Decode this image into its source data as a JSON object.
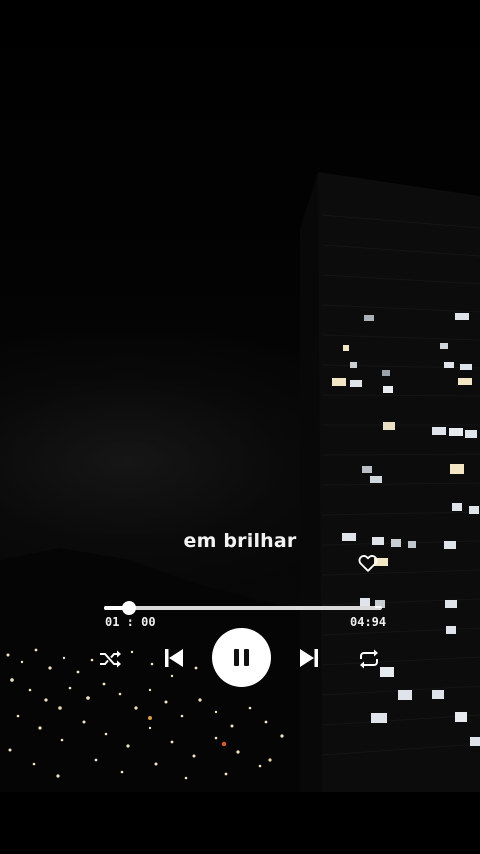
{
  "player": {
    "lyric": "em brilhar",
    "time_elapsed": "01 : 00",
    "time_total": "04:94",
    "progress_fraction": 0.09,
    "is_playing": true,
    "liked": false
  },
  "icons": {
    "heart": "heart-icon",
    "shuffle": "shuffle-icon",
    "previous": "skip-previous-icon",
    "pause": "pause-icon",
    "next": "skip-next-icon",
    "repeat": "repeat-icon"
  },
  "colors": {
    "background": "#000000",
    "foreground": "#ffffff",
    "window_light_warm": "#f3e6c4",
    "window_light_cool": "#dfe4ea"
  }
}
